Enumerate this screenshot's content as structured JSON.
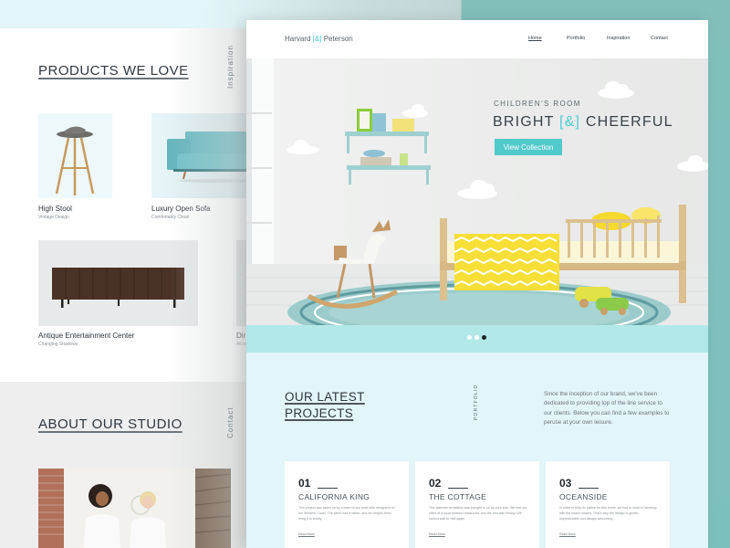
{
  "colors": {
    "accent": "#52c9cb",
    "bracket_accent": "#4fcdd0",
    "pale_background": "#e2f5f8",
    "teal_background": "#82bfbb",
    "hero_strip": "#b3e8e9",
    "text_dark": "#2f3740"
  },
  "left_page": {
    "products_section": {
      "title": "PRODUCTS WE LOVE",
      "side_label": "Inspiration",
      "items": [
        {
          "name": "High Stool",
          "subtitle": "Vintage Design",
          "image": "bar-stool-image"
        },
        {
          "name": "Luxury Open Sofa",
          "subtitle": "Comfortably Clean",
          "image": "teal-sofa-image"
        },
        {
          "name": "Antique Entertainment Center",
          "subtitle": "Changing Shadows",
          "image": "wood-sideboard-image"
        },
        {
          "name": "Dir",
          "subtitle": "All In",
          "image": "partial-product-image"
        }
      ]
    },
    "about_section": {
      "title": "ABOUT OUR STUDIO",
      "side_label": "Contact",
      "image": "studio-team-photo"
    }
  },
  "main_page": {
    "nav": {
      "brand_left": "Harvard",
      "brand_amp": "[&]",
      "brand_right": "Peterson",
      "items": [
        {
          "label": "Home",
          "active": true
        },
        {
          "label": "Portfolio",
          "active": false
        },
        {
          "label": "Inspiration",
          "active": false
        },
        {
          "label": "Contact",
          "active": false
        }
      ]
    },
    "hero": {
      "eyebrow": "CHILDREN'S ROOM",
      "title_left": "BRIGHT",
      "title_amp": "[&]",
      "title_right": "CHEERFUL",
      "button_label": "View Collection",
      "slides_total": 3,
      "active_slide": 3,
      "image": "childrens-room-photo"
    },
    "projects": {
      "title_line1": "OUR LATEST",
      "title_line2": "PROJECTS",
      "side_label": "PORTFOLIO",
      "description": "Since the inception of our brand, we've been dedicated to providing top of the line service to our clients. Below you can find a few examples to peruse at your own leisure.",
      "cards": [
        {
          "number": "01",
          "title": "CALIFORNIA KING",
          "text": "This project was taken on by a team of our most elite designers on the Western Coast. The client had a vision, and we helped them bring it to reality.",
          "link": "Read More"
        },
        {
          "number": "02",
          "title": "THE COTTAGE",
          "text": "This lakeside sensation was brought to us by pure luck. We met our client at a local seafood restaurant, and the rest was history. We cannot wait to visit again.",
          "link": "Read More"
        },
        {
          "number": "03",
          "title": "OCEANSIDE",
          "text": "In order to fully do justice for this home, we had to work in harmony with the beach nearby. That's why the design is gentle, unpredictable and always welcoming.",
          "link": "Read More"
        }
      ]
    }
  }
}
